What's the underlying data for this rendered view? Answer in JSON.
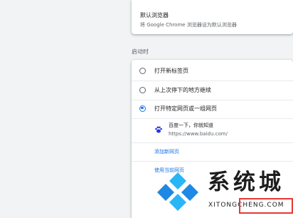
{
  "default_browser": {
    "title": "默认浏览器",
    "subtitle": "将 Google Chrome 浏览器设为默认浏览器"
  },
  "startup": {
    "section_label": "启动时",
    "options": [
      {
        "label": "打开新标签页",
        "checked": false
      },
      {
        "label": "从上次停下的地方继续",
        "checked": false
      },
      {
        "label": "打开特定网页或一组网页",
        "checked": true
      }
    ],
    "pages": [
      {
        "name": "百度一下，你就知道",
        "url": "https://www.baidu.com/",
        "icon": "baidu-paw-icon"
      }
    ],
    "add_page_link": "添加新网页",
    "use_current_link": "使用当前网页"
  },
  "watermark": {
    "brand": "系统城",
    "url": "XITONGCHENG.COM",
    "logo_colors": [
      "#1e88e5",
      "#29b6f6"
    ],
    "highlight_color": "#e53935"
  }
}
